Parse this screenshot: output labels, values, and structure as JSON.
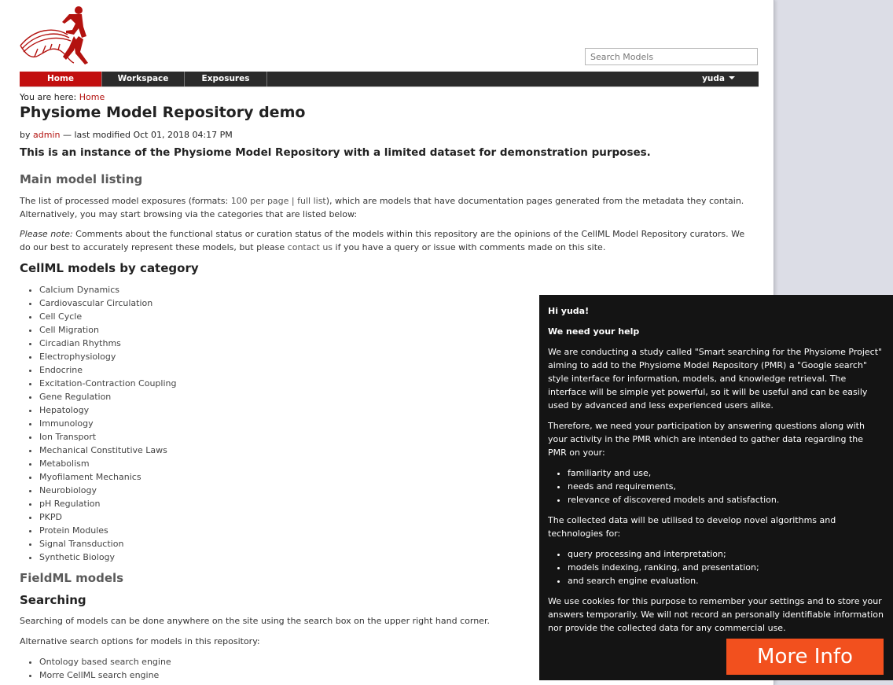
{
  "header": {
    "search_placeholder": "Search Models"
  },
  "nav": {
    "tabs": [
      {
        "label": "Home"
      },
      {
        "label": "Workspace"
      },
      {
        "label": "Exposures"
      }
    ],
    "user": "yuda"
  },
  "breadcrumb": {
    "prefix": "You are here: ",
    "home": "Home"
  },
  "content": {
    "title": "Physiome Model Repository demo",
    "byline": {
      "by": "by ",
      "author": "admin",
      "modified": " — last modified Oct 01, 2018 04:17 PM"
    },
    "lead": "This is an instance of the Physiome Model Repository with a limited dataset for demonstration purposes.",
    "main_listing": {
      "heading": "Main model listing",
      "text_a": "The list of processed model exposures (formats: ",
      "link_100": "100 per page",
      "sep": " | ",
      "link_full": "full list",
      "text_b": "), which are models that have documentation pages generated from the metadata they contain. Alternatively, you may start browsing via the categories that are listed below:",
      "note_label": "Please note:",
      "note_a": " Comments about the functional status or curation status of the models within this repository are the opinions of the CellML Model Repository curators. We do our best to accurately represent these models, but please ",
      "note_link": "contact us",
      "note_b": " if you have a query or issue with comments made on this site."
    },
    "cellml": {
      "heading": "CellML models by category",
      "categories": [
        "Calcium Dynamics",
        "Cardiovascular Circulation",
        "Cell Cycle",
        "Cell Migration",
        "Circadian Rhythms",
        "Electrophysiology",
        "Endocrine",
        "Excitation-Contraction Coupling",
        "Gene Regulation",
        "Hepatology",
        "Immunology",
        "Ion Transport",
        "Mechanical Constitutive Laws",
        "Metabolism",
        "Myofilament Mechanics",
        "Neurobiology",
        "pH Regulation",
        "PKPD",
        "Protein Modules",
        "Signal Transduction",
        "Synthetic Biology"
      ]
    },
    "fieldml": {
      "heading": "FieldML models"
    },
    "searching": {
      "heading": "Searching",
      "text": "Searching of models can be done anywhere on the site using the search box on the upper right hand corner.",
      "alt_text": "Alternative search options for models in this repository:",
      "options": [
        "Ontology based search engine",
        "Morre CellML search engine"
      ]
    }
  },
  "popup": {
    "greeting": "Hi yuda!",
    "heading": "We need your help",
    "p1": "We are conducting a study called \"Smart searching for the Physiome Project\" aiming to add to the Physiome Model Repository (PMR) a \"Google search\" style interface for information, models, and knowledge retrieval. The interface will be simple yet powerful, so it will be useful and can be easily used by advanced and less experienced users alike.",
    "p2": "Therefore, we need your participation by answering questions along with your activity in the PMR which are intended to gather data regarding the PMR on your:",
    "list1": [
      "familiarity and use,",
      "needs and requirements,",
      "relevance of discovered models and satisfaction."
    ],
    "p3": "The collected data will be utilised to develop novel algorithms and technologies for:",
    "list2": [
      "query processing and interpretation;",
      "models indexing, ranking, and presentation;",
      "and search engine evaluation."
    ],
    "p4": "We use cookies for this purpose to remember your settings and to store your answers temporarily. We will not record an personally identifiable information nor provide the collected data for any commercial use.",
    "button": "More Info"
  },
  "colors": {
    "accent_red": "#c20f0f",
    "link_red": "#b3120f",
    "nav_bg": "#2b2b2b",
    "popup_bg": "#141414",
    "more_info_orange": "#f2501e"
  },
  "icons": {
    "logo": "physiome-runner-dna-logo",
    "user_menu": "caret-down-icon"
  }
}
